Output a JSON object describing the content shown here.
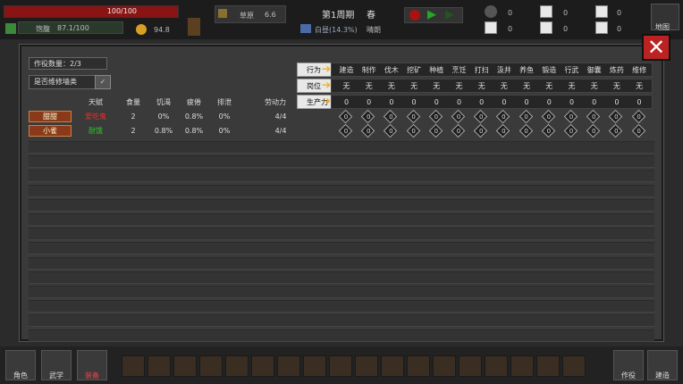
{
  "top": {
    "hp": "100/100",
    "satiety_label": "饱腹",
    "satiety_value": "87.1/100",
    "mood_value": "94.8",
    "terrain": "草原",
    "terrain_value": "6.6",
    "period": "第1周期",
    "season": "春",
    "day_label": "白昼(14.3%)",
    "weather": "晴朗",
    "res1": "0",
    "res2": "0",
    "res3": "0",
    "res4": "0",
    "res5": "0",
    "res6": "0",
    "map_label": "地图"
  },
  "panel": {
    "worker_count": "作役数量：2/3",
    "repair_filter": "是否维修墙类",
    "headers": {
      "talent": "天赋",
      "food": "食量",
      "hunger": "饥渴",
      "fatigue": "疲倦",
      "excrete": "排泄",
      "labor": "劳动力"
    },
    "row_labels": {
      "action": "行为",
      "post": "岗位",
      "productivity": "生产力"
    },
    "jobs": [
      "建造",
      "制作",
      "伐木",
      "挖矿",
      "种植",
      "烹饪",
      "打扫",
      "汲井",
      "养鱼",
      "锻造",
      "行武",
      "御囊",
      "炼药",
      "维修"
    ],
    "posts": [
      "无",
      "无",
      "无",
      "无",
      "无",
      "无",
      "无",
      "无",
      "无",
      "无",
      "无",
      "无",
      "无",
      "无"
    ],
    "productivity": [
      "0",
      "0",
      "0",
      "0",
      "0",
      "0",
      "0",
      "0",
      "0",
      "0",
      "0",
      "0",
      "0",
      "0"
    ],
    "workers": [
      {
        "name": "甜甜",
        "talent": "爱吃鬼",
        "food": "2",
        "hunger": "0%",
        "fatigue": "0.8%",
        "excrete": "0%",
        "labor": "4/4",
        "cells": [
          "0",
          "0",
          "0",
          "0",
          "0",
          "0",
          "0",
          "0",
          "0",
          "0",
          "0",
          "0",
          "0",
          "0"
        ]
      },
      {
        "name": "小雀",
        "talent": "耐饿",
        "food": "2",
        "hunger": "0.8%",
        "fatigue": "0.8%",
        "excrete": "0%",
        "labor": "4/4",
        "cells": [
          "0",
          "0",
          "0",
          "0",
          "0",
          "0",
          "0",
          "0",
          "0",
          "0",
          "0",
          "0",
          "0",
          "0"
        ]
      }
    ],
    "talent_colors": [
      "#e83030",
      "#30c030"
    ]
  },
  "bottom": {
    "role": "角色",
    "martial": "武学",
    "third": "装备",
    "labor": "作役",
    "build": "建造"
  }
}
